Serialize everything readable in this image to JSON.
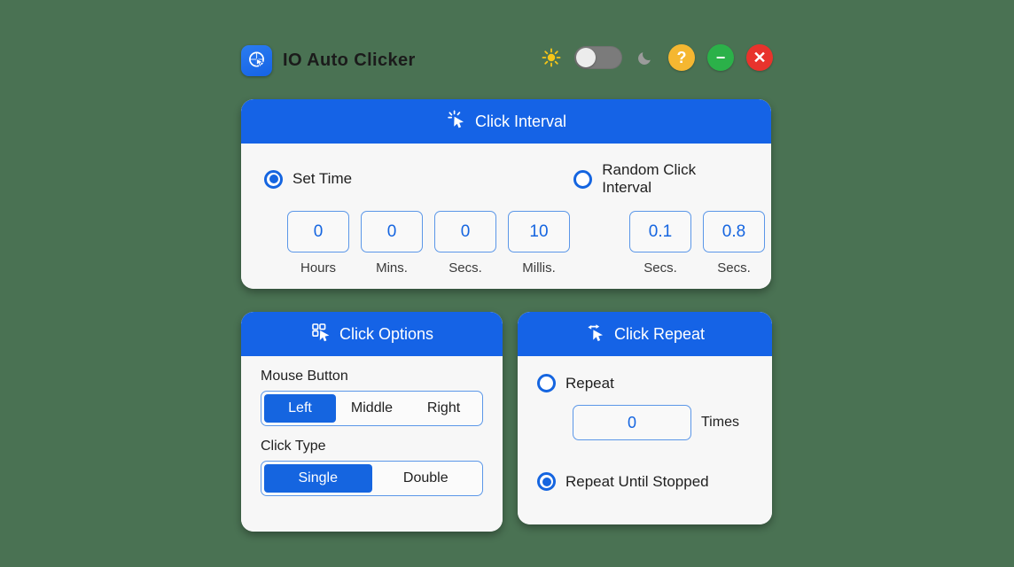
{
  "window": {
    "title": "IO Auto Clicker",
    "app_icon": "auto-clicker-app-icon",
    "background_color": "#4a7253",
    "accent_color": "#1565e0"
  },
  "titlebar_controls": {
    "sun_icon": "sun-icon",
    "theme_toggle": {
      "state": "off",
      "knob_side": "left",
      "track_color": "#7b7b7b"
    },
    "moon_icon": "moon-icon",
    "help_label": "?",
    "help_color": "#f5b731",
    "minimize_label": "−",
    "minimize_color": "#2bb149",
    "close_label": "✕",
    "close_color": "#e8332c"
  },
  "click_interval": {
    "header": "Click Interval",
    "header_icon": "click-cursor-sparkle-icon",
    "set_time": {
      "label": "Set Time",
      "selected": true
    },
    "random": {
      "label": "Random Click Interval",
      "selected": false
    },
    "time_fields": [
      {
        "value": "0",
        "label": "Hours"
      },
      {
        "value": "0",
        "label": "Mins."
      },
      {
        "value": "0",
        "label": "Secs."
      },
      {
        "value": "10",
        "label": "Millis."
      }
    ],
    "random_fields": [
      {
        "value": "0.1",
        "label": "Secs."
      },
      {
        "value": "0.8",
        "label": "Secs."
      }
    ]
  },
  "click_options": {
    "header": "Click Options",
    "header_icon": "grid-cursor-icon",
    "mouse_button": {
      "label": "Mouse Button",
      "options": [
        "Left",
        "Middle",
        "Right"
      ],
      "selected": "Left"
    },
    "click_type": {
      "label": "Click Type",
      "options": [
        "Single",
        "Double"
      ],
      "selected": "Single"
    }
  },
  "click_repeat": {
    "header": "Click Repeat",
    "header_icon": "repeat-cursor-icon",
    "repeat": {
      "label": "Repeat",
      "selected": false
    },
    "repeat_count": {
      "value": "0",
      "unit_label": "Times"
    },
    "repeat_until_stopped": {
      "label": "Repeat Until Stopped",
      "selected": true
    }
  }
}
